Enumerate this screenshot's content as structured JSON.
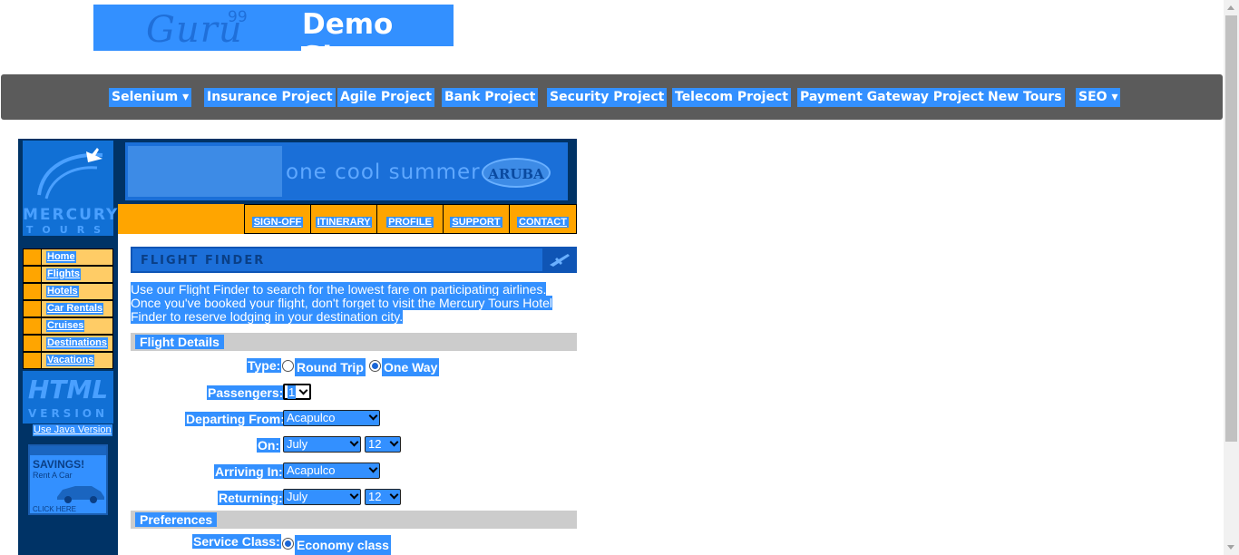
{
  "header": {
    "logo_text": "Guru",
    "logo_sup": "99",
    "site_title": "Demo Site"
  },
  "nav": {
    "items": [
      {
        "label": "Selenium",
        "dropdown": true
      },
      {
        "label": "Insurance Project"
      },
      {
        "label": "Agile Project"
      },
      {
        "label": "Bank Project"
      },
      {
        "label": "Security Project"
      },
      {
        "label": "Telecom Project"
      },
      {
        "label": "Payment Gateway Project"
      },
      {
        "label": "New Tours"
      },
      {
        "label": "SEO",
        "dropdown": true
      }
    ]
  },
  "sidebar": {
    "brand": "MERCURY",
    "brand_sub": "TOURS",
    "menu": [
      "Home",
      "Flights",
      "Hotels",
      "Car Rentals",
      "Cruises",
      "Destinations",
      "Vacations"
    ],
    "html_version": "HTML",
    "html_version_sub": "VERSION",
    "java_link": "Use Java Version",
    "ad": {
      "title": "SAVINGS!",
      "sub": "Rent A Car",
      "cta": "CLICK HERE"
    }
  },
  "banner": {
    "text": "one cool summer",
    "brand": "ARUBA"
  },
  "top_links": [
    "SIGN-OFF",
    "ITINERARY",
    "PROFILE",
    "SUPPORT",
    "CONTACT"
  ],
  "finder": {
    "header": "FLIGHT FINDER",
    "intro": "Use our Flight Finder to search for the lowest fare on participating airlines. Once you've booked your flight, don't forget to visit the Mercury Tours Hotel Finder to reserve lodging in your destination city.",
    "flight_details_title": "Flight Details",
    "type_label": "Type:",
    "type_options": [
      "Round Trip",
      "One Way"
    ],
    "type_selected": "One Way",
    "passengers_label": "Passengers:",
    "passengers_value": "1",
    "departing_label": "Departing From:",
    "departing_value": "Acapulco",
    "on_label": "On:",
    "on_month": "July",
    "on_day": "12",
    "arriving_label": "Arriving In:",
    "arriving_value": "Acapulco",
    "returning_label": "Returning:",
    "returning_month": "July",
    "returning_day": "12",
    "preferences_title": "Preferences",
    "service_class_label": "Service Class:",
    "service_class_value": "Economy class"
  },
  "colors": {
    "selection": "#3390ff",
    "nav_bg": "#5b5b5b",
    "sidebar_bg": "#003366",
    "orange": "#ffa500"
  }
}
